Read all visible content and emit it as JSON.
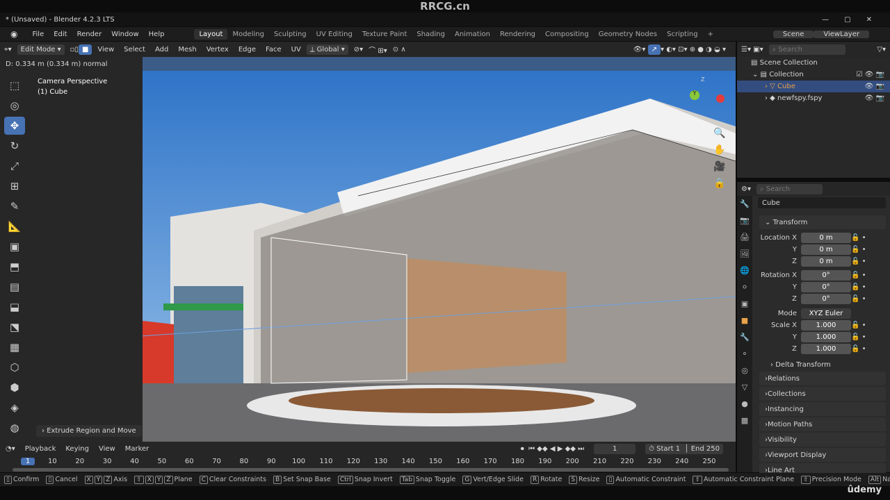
{
  "watermark": "RRCG.cn",
  "window_title": "* (Unsaved) - Blender 4.2.3 LTS",
  "menu": [
    "File",
    "Edit",
    "Render",
    "Window",
    "Help"
  ],
  "workspaces": [
    "Layout",
    "Modeling",
    "Sculpting",
    "UV Editing",
    "Texture Paint",
    "Shading",
    "Animation",
    "Rendering",
    "Compositing",
    "Geometry Nodes",
    "Scripting",
    "+"
  ],
  "active_workspace": "Layout",
  "scene": "Scene",
  "view_layer": "ViewLayer",
  "viewport_header": {
    "mode": "Edit Mode",
    "menus": [
      "View",
      "Select",
      "Add",
      "Mesh",
      "Vertex",
      "Edge",
      "Face",
      "UV"
    ],
    "orientation": "Global"
  },
  "operator_status": "D: 0.334 m (0.334 m) normal",
  "viewport": {
    "camera": "Camera Perspective",
    "object": "(1) Cube",
    "last_op": "Extrude Region and Move"
  },
  "outliner": {
    "search_placeholder": "Search",
    "items": [
      "Scene Collection",
      "Collection",
      "Cube",
      "newfspy.fspy"
    ]
  },
  "properties": {
    "search_placeholder": "Search",
    "object_name": "Cube",
    "transform_label": "Transform",
    "location": {
      "label": "Location X",
      "values": [
        "0 m",
        "0 m",
        "0 m"
      ]
    },
    "rotation": {
      "label": "Rotation X",
      "values": [
        "0°",
        "0°",
        "0°"
      ]
    },
    "mode_label": "Mode",
    "mode_value": "XYZ Euler",
    "scale": {
      "label": "Scale X",
      "values": [
        "1.000",
        "1.000",
        "1.000"
      ]
    },
    "axis": [
      "Y",
      "Z"
    ],
    "delta": "Delta Transform",
    "sections": [
      "Relations",
      "Collections",
      "Instancing",
      "Motion Paths",
      "Visibility",
      "Viewport Display",
      "Line Art"
    ]
  },
  "timeline": {
    "menus": [
      "Playback",
      "Keying",
      "View",
      "Marker"
    ],
    "current_frame": "1",
    "start_label": "Start",
    "start": "1",
    "end_label": "End",
    "end": "250",
    "ticks": [
      "1",
      "10",
      "20",
      "30",
      "40",
      "50",
      "60",
      "70",
      "80",
      "90",
      "100",
      "110",
      "120",
      "130",
      "140",
      "150",
      "160",
      "170",
      "180",
      "190",
      "200",
      "210",
      "220",
      "230",
      "240",
      "250"
    ]
  },
  "statusbar": [
    {
      "keys": [],
      "label": "Confirm"
    },
    {
      "keys": [],
      "label": "Cancel"
    },
    {
      "keys": [
        "X",
        "Y",
        "Z"
      ],
      "label": "Axis"
    },
    {
      "keys": [
        "⇧",
        "X",
        "Y",
        "Z"
      ],
      "label": "Plane"
    },
    {
      "keys": [
        "C"
      ],
      "label": "Clear Constraints"
    },
    {
      "keys": [
        "B"
      ],
      "label": "Set Snap Base"
    },
    {
      "keys": [
        "Ctrl"
      ],
      "label": "Snap Invert"
    },
    {
      "keys": [
        "Tab"
      ],
      "label": "Snap Toggle"
    },
    {
      "keys": [
        "G"
      ],
      "label": "Vert/Edge Slide"
    },
    {
      "keys": [
        "R"
      ],
      "label": "Rotate"
    },
    {
      "keys": [
        "S"
      ],
      "label": "Resize"
    },
    {
      "keys": [],
      "label": "Automatic Constraint"
    },
    {
      "keys": [
        "⇧"
      ],
      "label": "Automatic Constraint Plane"
    },
    {
      "keys": [
        "⇧"
      ],
      "label": "Precision Mode"
    },
    {
      "keys": [
        "Alt"
      ],
      "label": "Navigate"
    }
  ],
  "udemy": "ûdemy",
  "colors": {
    "accent": "#4772b3",
    "selected_object": "#e8a24a"
  }
}
